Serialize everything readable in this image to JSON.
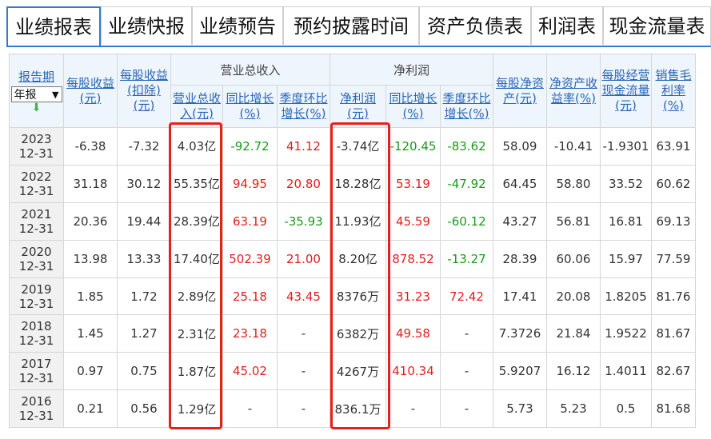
{
  "tabs": [
    "业绩报表",
    "业绩快报",
    "业绩预告",
    "预约披露时间",
    "资产负债表",
    "利润表",
    "现金流量表"
  ],
  "header": {
    "period": "报告期",
    "period_select": "年报",
    "eps": "每股收益(元)",
    "eps_deducted": "每股收益(扣除)(元)",
    "revenue_group": "营业总收入",
    "revenue": "营业总收入(元)",
    "revenue_yoy": "同比增长(%)",
    "revenue_qoq": "季度环比增长(%)",
    "profit_group": "净利润",
    "profit": "净利润(元)",
    "profit_yoy": "同比增长(%)",
    "profit_qoq": "季度环比增长(%)",
    "bvps": "每股净资产(元)",
    "roe": "净资产收益率(%)",
    "ocfps": "每股经营现金流量(元)",
    "gross_margin": "销售毛利率(%)"
  },
  "rows": [
    {
      "year": "2023",
      "md": "12-31",
      "eps": "-6.38",
      "eps_d": "-7.32",
      "rev": "4.03亿",
      "rev_yoy": "-92.72",
      "rev_qoq": "41.12",
      "np": "-3.74亿",
      "np_yoy": "-120.45",
      "np_qoq": "-83.62",
      "bvps": "58.09",
      "roe": "-10.41",
      "ocf": "-1.9301",
      "gm": "63.91"
    },
    {
      "year": "2022",
      "md": "12-31",
      "eps": "31.18",
      "eps_d": "30.12",
      "rev": "55.35亿",
      "rev_yoy": "94.95",
      "rev_qoq": "20.80",
      "np": "18.28亿",
      "np_yoy": "53.19",
      "np_qoq": "-47.92",
      "bvps": "64.45",
      "roe": "58.80",
      "ocf": "33.52",
      "gm": "60.62"
    },
    {
      "year": "2021",
      "md": "12-31",
      "eps": "20.36",
      "eps_d": "19.44",
      "rev": "28.39亿",
      "rev_yoy": "63.19",
      "rev_qoq": "-35.93",
      "np": "11.93亿",
      "np_yoy": "45.59",
      "np_qoq": "-60.12",
      "bvps": "43.27",
      "roe": "56.81",
      "ocf": "16.81",
      "gm": "69.13"
    },
    {
      "year": "2020",
      "md": "12-31",
      "eps": "13.98",
      "eps_d": "13.33",
      "rev": "17.40亿",
      "rev_yoy": "502.39",
      "rev_qoq": "21.00",
      "np": "8.20亿",
      "np_yoy": "878.52",
      "np_qoq": "-13.27",
      "bvps": "28.39",
      "roe": "60.06",
      "ocf": "15.97",
      "gm": "77.59"
    },
    {
      "year": "2019",
      "md": "12-31",
      "eps": "1.85",
      "eps_d": "1.72",
      "rev": "2.89亿",
      "rev_yoy": "25.18",
      "rev_qoq": "43.45",
      "np": "8376万",
      "np_yoy": "31.23",
      "np_qoq": "72.42",
      "bvps": "17.41",
      "roe": "20.08",
      "ocf": "1.8205",
      "gm": "81.76"
    },
    {
      "year": "2018",
      "md": "12-31",
      "eps": "1.45",
      "eps_d": "1.27",
      "rev": "2.31亿",
      "rev_yoy": "23.18",
      "rev_qoq": "-",
      "np": "6382万",
      "np_yoy": "49.58",
      "np_qoq": "-",
      "bvps": "7.3726",
      "roe": "21.84",
      "ocf": "1.9522",
      "gm": "81.67"
    },
    {
      "year": "2017",
      "md": "12-31",
      "eps": "0.97",
      "eps_d": "0.75",
      "rev": "1.87亿",
      "rev_yoy": "45.02",
      "rev_qoq": "-",
      "np": "4267万",
      "np_yoy": "410.34",
      "np_qoq": "-",
      "bvps": "5.9207",
      "roe": "16.12",
      "ocf": "1.4011",
      "gm": "82.67"
    },
    {
      "year": "2016",
      "md": "12-31",
      "eps": "0.21",
      "eps_d": "0.56",
      "rev": "1.29亿",
      "rev_yoy": "-",
      "rev_qoq": "-",
      "np": "836.1万",
      "np_yoy": "-",
      "np_qoq": "-",
      "bvps": "5.73",
      "roe": "5.23",
      "ocf": "0.5",
      "gm": "81.68"
    }
  ],
  "colors": {
    "positive": "#e02020",
    "negative": "#1a9a1a",
    "highlight": "#e8201a",
    "tab_active": "#2f7bd5"
  }
}
